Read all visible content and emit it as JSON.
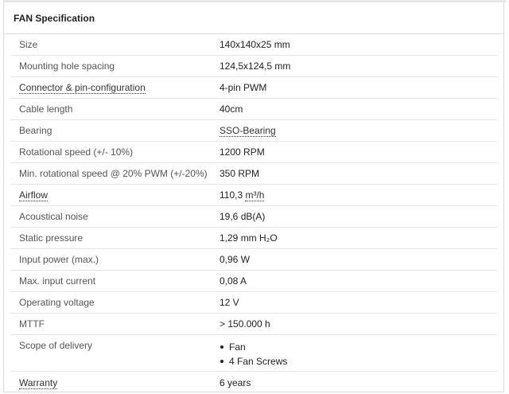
{
  "panel": {
    "title": "FAN Specification"
  },
  "specs": {
    "size": {
      "label": "Size",
      "value": "140x140x25 mm"
    },
    "mounting": {
      "label": "Mounting hole spacing",
      "value": "124,5x124,5 mm"
    },
    "connector": {
      "label": "Connector & pin-configuration",
      "value": "4-pin PWM"
    },
    "cable": {
      "label": "Cable length",
      "value": "40cm"
    },
    "bearing": {
      "label": "Bearing",
      "value": "SSO-Bearing"
    },
    "speed": {
      "label": "Rotational speed (+/- 10%)",
      "value": "1200 RPM"
    },
    "min_speed": {
      "label": "Min. rotational speed @ 20% PWM (+/-20%)",
      "value": "350 RPM"
    },
    "airflow": {
      "label": "Airflow",
      "value_number": "110,3 ",
      "value_unit": "m³/h"
    },
    "noise": {
      "label": "Acoustical noise",
      "value": "19,6 dB(A)"
    },
    "pressure": {
      "label": "Static pressure",
      "value": "1,29 mm H₂O"
    },
    "power": {
      "label": "Input power (max.)",
      "value": "0,96 W"
    },
    "current": {
      "label": "Max. input current",
      "value": "0,08 A"
    },
    "voltage": {
      "label": "Operating voltage",
      "value": "12 V"
    },
    "mttf": {
      "label": "MTTF",
      "value": "> 150.000 h"
    },
    "delivery": {
      "label": "Scope of delivery",
      "items": [
        "Fan",
        "4 Fan Screws"
      ]
    },
    "warranty": {
      "label": "Warranty",
      "value": "6 years"
    }
  }
}
